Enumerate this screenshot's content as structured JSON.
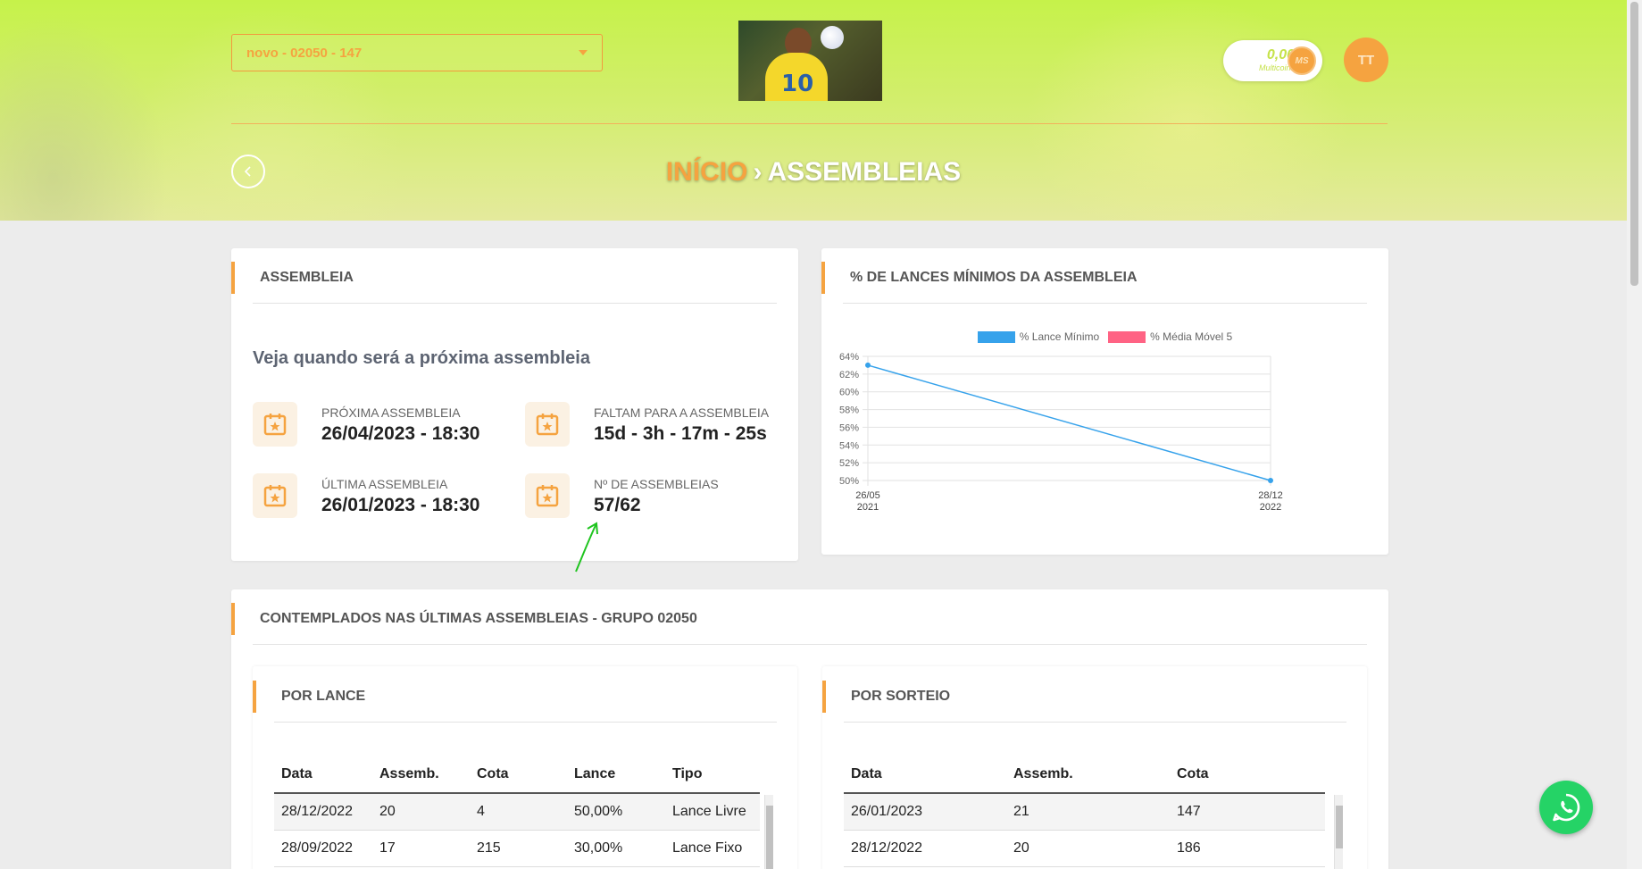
{
  "header": {
    "group_select_value": "novo - 02050 - 147",
    "coin_value": "0,00",
    "coin_caption": "Multicoins",
    "coin_symbol": "MS",
    "avatar_initials": "TT",
    "breadcrumb_home": "INÍCIO",
    "breadcrumb_separator": "›",
    "breadcrumb_current": "ASSEMBLEIAS"
  },
  "assembly": {
    "title": "ASSEMBLEIA",
    "subtitle": "Veja quando será a próxima assembleia",
    "stats": [
      {
        "label": "PRÓXIMA ASSEMBLEIA",
        "value": "26/04/2023 - 18:30"
      },
      {
        "label": "FALTAM PARA A ASSEMBLEIA",
        "value": "15d - 3h - 17m - 25s"
      },
      {
        "label": "ÚLTIMA ASSEMBLEIA",
        "value": "26/01/2023 - 18:30"
      },
      {
        "label": "Nº DE ASSEMBLEIAS",
        "value": "57/62"
      }
    ]
  },
  "chart_card": {
    "title": "% DE LANCES MÍNIMOS DA ASSEMBLEIA"
  },
  "chart_data": {
    "type": "line",
    "x": [
      [
        "26/05",
        "2021"
      ],
      [
        "28/12",
        "2022"
      ]
    ],
    "series": [
      {
        "name": "% Lance Mínimo",
        "color": "#36a2eb",
        "values": [
          63,
          50
        ]
      },
      {
        "name": "% Média Móvel 5",
        "color": "#ff6384",
        "values": []
      }
    ],
    "ylim": [
      50,
      64
    ],
    "yticks": [
      "50%",
      "52%",
      "54%",
      "56%",
      "58%",
      "60%",
      "62%",
      "64%"
    ],
    "grid": true,
    "legend": "top"
  },
  "contemplated": {
    "title": "CONTEMPLADOS NAS ÚLTIMAS ASSEMBLEIAS - GRUPO 02050",
    "by_bid": {
      "title": "POR LANCE",
      "columns": [
        "Data",
        "Assemb.",
        "Cota",
        "Lance",
        "Tipo"
      ],
      "rows": [
        [
          "28/12/2022",
          "20",
          "4",
          "50,00%",
          "Lance Livre"
        ],
        [
          "28/09/2022",
          "17",
          "215",
          "30,00%",
          "Lance Fixo"
        ]
      ]
    },
    "by_draw": {
      "title": "POR SORTEIO",
      "columns": [
        "Data",
        "Assemb.",
        "Cota"
      ],
      "rows": [
        [
          "26/01/2023",
          "21",
          "147"
        ],
        [
          "28/12/2022",
          "20",
          "186"
        ]
      ]
    }
  },
  "colors": {
    "accent": "#f5a340",
    "whatsapp": "#25d366"
  }
}
